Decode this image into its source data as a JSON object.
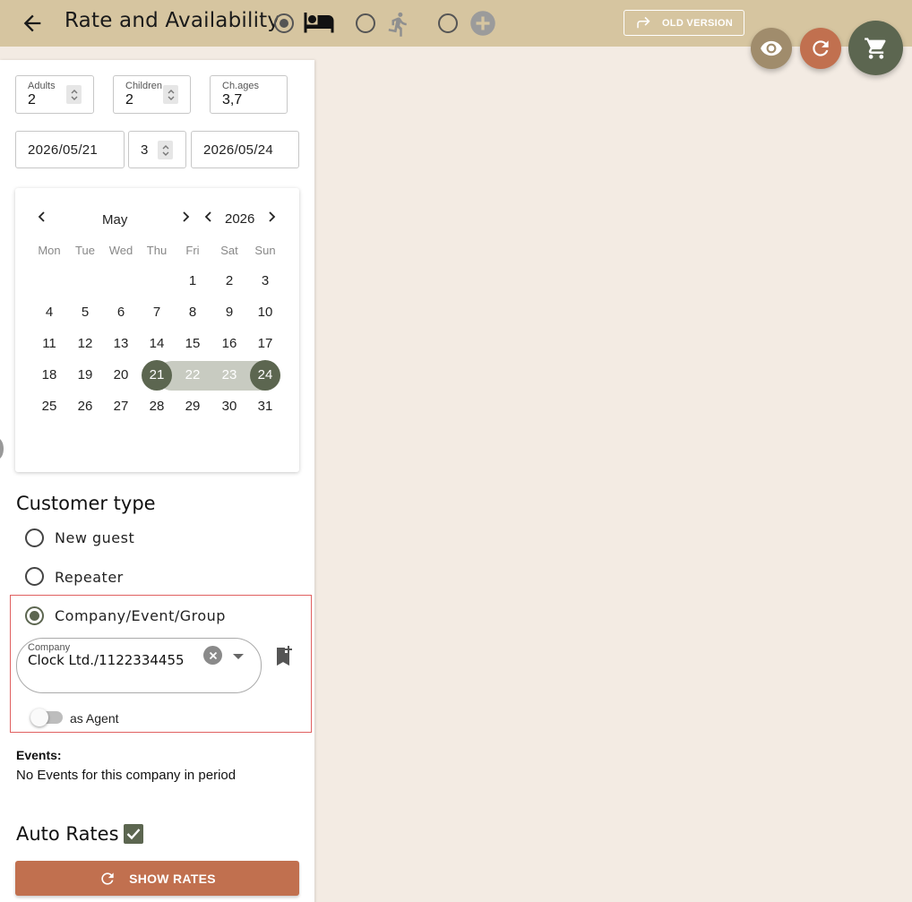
{
  "header": {
    "title": "Rate and Availability",
    "old_version_label": "OLD VERSION"
  },
  "colors": {
    "header_bg": "#d6c5a0",
    "accent": "#5c6650",
    "action": "#c1704f",
    "page_bg": "#f3ebe3"
  },
  "guests": {
    "adults_label": "Adults",
    "adults_value": "2",
    "children_label": "Children",
    "children_value": "2",
    "ages_label": "Ch.ages",
    "ages_value": "3,7"
  },
  "dates": {
    "arrival": "2026/05/21",
    "nights": "3",
    "departure": "2026/05/24"
  },
  "calendar": {
    "month": "May",
    "year": "2026",
    "weekdays": [
      "Mon",
      "Tue",
      "Wed",
      "Thu",
      "Fri",
      "Sat",
      "Sun"
    ],
    "weeks": [
      [
        "",
        "",
        "",
        "",
        "1",
        "2",
        "3"
      ],
      [
        "4",
        "5",
        "6",
        "7",
        "8",
        "9",
        "10"
      ],
      [
        "11",
        "12",
        "13",
        "14",
        "15",
        "16",
        "17"
      ],
      [
        "18",
        "19",
        "20",
        "21",
        "22",
        "23",
        "24"
      ],
      [
        "25",
        "26",
        "27",
        "28",
        "29",
        "30",
        "31"
      ]
    ],
    "range_start": "21",
    "range_end": "24"
  },
  "customer": {
    "title": "Customer type",
    "options": [
      "New guest",
      "Repeater",
      "Company/Event/Group"
    ],
    "selected": "Company/Event/Group",
    "company_label": "Company",
    "company_value": "Clock Ltd./1122334455",
    "agent_label": "as Agent"
  },
  "events": {
    "heading": "Events:",
    "text": "No Events for this company in period"
  },
  "auto_rates": {
    "label": "Auto Rates",
    "checked": true
  },
  "show_rates_label": "SHOW RATES"
}
